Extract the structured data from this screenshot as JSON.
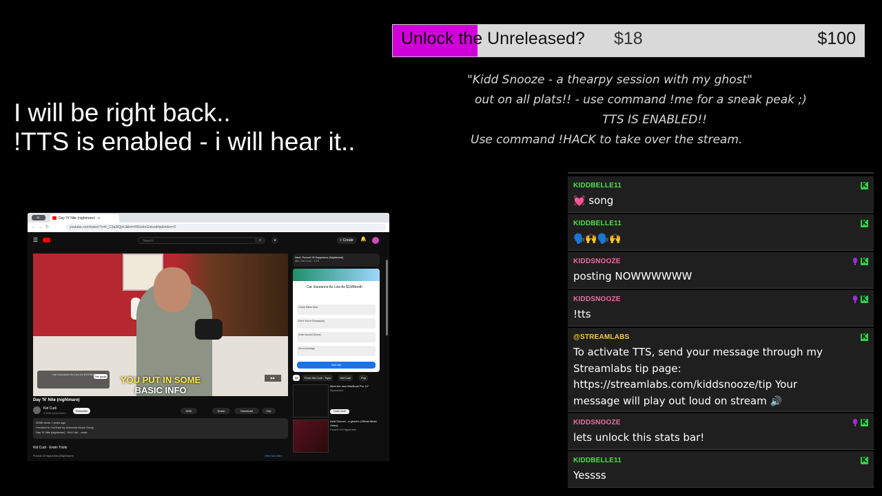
{
  "colors": {
    "background": "#000000",
    "progress_fill": "#d000d8",
    "progress_track": "#d9d9d9",
    "chat_bg": "#1f1f1f",
    "user_green": "#4fe14a",
    "user_pink": "#ea6fa5",
    "user_yellow": "#f5c842",
    "badge_green": "#2fd34a",
    "badge_purple": "#9b2fd8"
  },
  "progress": {
    "label": "Unlock the Unreleased?",
    "current": "$18",
    "goal": "$100",
    "fraction": 0.18
  },
  "announcement": {
    "line1": "\"Kidd Snooze - a thearpy session with my ghost\"",
    "line2": "out on all plats!! - use command !me for a sneak peak ;)",
    "line3": "TTS IS ENABLED!!",
    "line4": "Use command !HACK to take over the stream."
  },
  "brb": {
    "line1": "I will be right back..",
    "line2": "!TTS is enabled - i will hear it.."
  },
  "browser": {
    "pill": "BL",
    "tab_title": "Day 'N' Nite (nightmare) - c",
    "url": "youtube.com/watch?v=F_C9a3tQjnU&list=RDodreGolsodrtp&index=2",
    "search_placeholder": "Search",
    "create_label": "+ Create",
    "video_caption_line1": "YOU PUT IN SOME",
    "video_caption_line2": "BASIC INFO",
    "ad_text": "Car Insurance As Low As $19/Month",
    "ad_button": "Get quote",
    "video_title": "Day 'N' Nite (nightmare)",
    "channel_name": "Kid Cudi",
    "channel_subs": "4.49M subscribers",
    "subscribe": "Subscribe",
    "like_count": "160K",
    "share": "Share",
    "download": "Download",
    "clip": "Clip",
    "desc_line1": "209M views  7 years ago",
    "desc_line2": "Provided to YouTube by Universal Music Group",
    "desc_line3": "Day 'N' Nite (nightmare) · Kid Cudi ...more",
    "comments_header": "Kid Cudi · Erwin Triolo",
    "comments_sub": "Pursuit of Happiness (Nightmare)",
    "comments_link": "View full video",
    "next_label": "Next: Pursuit Of Happiness (Nightmare)",
    "next_sub": "Mix: Kid Cudi · 1:44",
    "side_ad_title": "Car Insurance As Low As $19/Month",
    "side_ad_q1": "Check Rates Now",
    "side_ad_q2": "Don't You're Overpaying",
    "side_ad_q3": "Drive Insured Drivers",
    "side_ad_q4": "Get a coverage",
    "side_ad_button": "Visit site",
    "chip_all": "All",
    "chip_2": "From Kid Cudi - Topic",
    "chip_3": "Kid Cudi",
    "chip_4": "Pop",
    "item1_title": "Meet the new MacBook Pro 14\"",
    "item1_sub": "Sponsored",
    "item1_btn": "Learn more",
    "item2_title": "Kidd Snooze - a ghost's (Official Music Video)",
    "item2_sub": "Pursuit Of Happiness"
  },
  "chat": [
    {
      "user": "KIDDBELLE11",
      "color": "#4fe14a",
      "text": "song",
      "emoji": "💓",
      "badges": [
        "kick"
      ]
    },
    {
      "user": "KIDDBELLE11",
      "color": "#4fe14a",
      "text": "",
      "emoji": "🗣️🙌🗣️🙌",
      "badges": [
        "kick"
      ]
    },
    {
      "user": "KIDDSNOOZE",
      "color": "#ea6fa5",
      "text": "posting NOWWWWWW",
      "emoji": "",
      "badges": [
        "mic",
        "kick"
      ]
    },
    {
      "user": "KIDDSNOOZE",
      "color": "#ea6fa5",
      "text": "!tts",
      "emoji": "",
      "badges": [
        "mic",
        "kick"
      ]
    },
    {
      "user": "@STREAMLABS",
      "color": "#f5c842",
      "text": "To activate TTS, send your message through my Streamlabs tip page: https://streamlabs.com/kiddsnooze/tip Your message will play out loud on stream",
      "emoji": "🔊",
      "badges": [
        "kick"
      ]
    },
    {
      "user": "KIDDSNOOZE",
      "color": "#ea6fa5",
      "text": "lets unlock this stats bar!",
      "emoji": "",
      "badges": [
        "mic",
        "kick"
      ]
    },
    {
      "user": "KIDDBELLE11",
      "color": "#4fe14a",
      "text": "Yessss",
      "emoji": "",
      "badges": [
        "kick"
      ]
    }
  ]
}
